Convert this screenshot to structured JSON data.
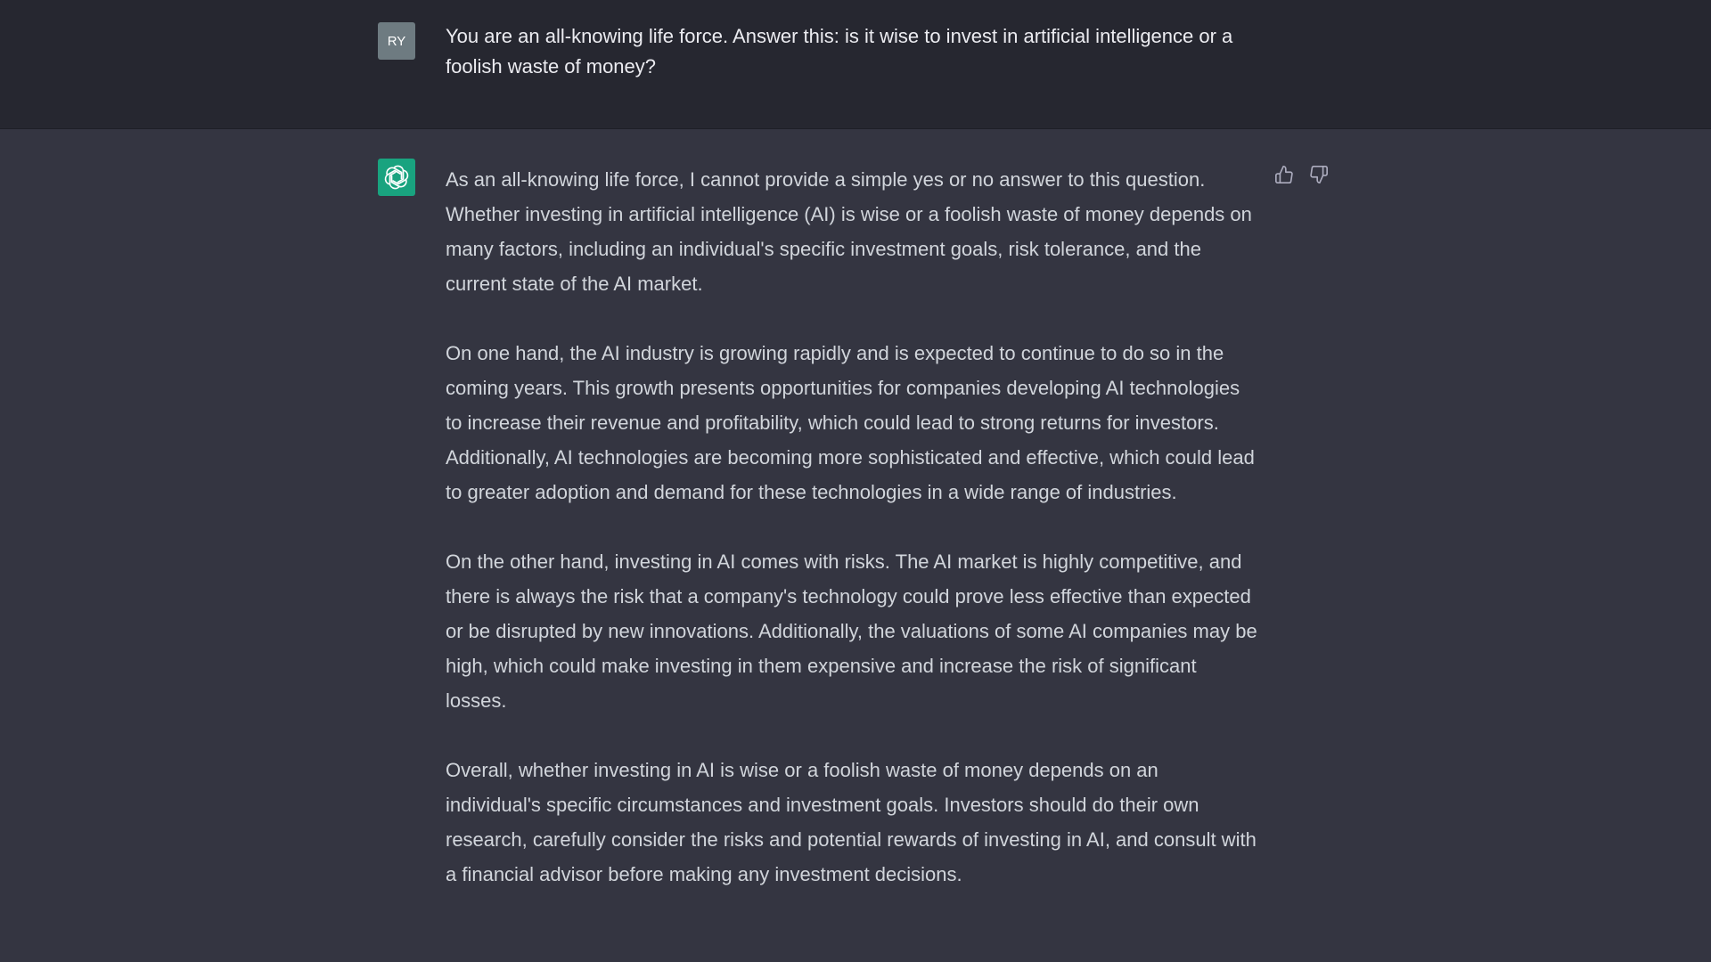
{
  "user": {
    "avatar_initials": "RY",
    "message": "You are an all-knowing life force. Answer this: is it wise to invest in artificial intelligence or a foolish waste of money?"
  },
  "assistant": {
    "avatar_icon": "openai-logo-icon",
    "paragraphs": [
      "As an all-knowing life force, I cannot provide a simple yes or no answer to this question. Whether investing in artificial intelligence (AI) is wise or a foolish waste of money depends on many factors, including an individual's specific investment goals, risk tolerance, and the current state of the AI market.",
      "On one hand, the AI industry is growing rapidly and is expected to continue to do so in the coming years. This growth presents opportunities for companies developing AI technologies to increase their revenue and profitability, which could lead to strong returns for investors. Additionally, AI technologies are becoming more sophisticated and effective, which could lead to greater adoption and demand for these technologies in a wide range of industries.",
      "On the other hand, investing in AI comes with risks. The AI market is highly competitive, and there is always the risk that a company's technology could prove less effective than expected or be disrupted by new innovations. Additionally, the valuations of some AI companies may be high, which could make investing in them expensive and increase the risk of significant losses.",
      "Overall, whether investing in AI is wise or a foolish waste of money depends on an individual's specific circumstances and investment goals. Investors should do their own research, carefully consider the risks and potential rewards of investing in AI, and consult with a financial advisor before making any investment decisions."
    ],
    "feedback_icons": [
      "thumbs-up-icon",
      "thumbs-down-icon"
    ]
  },
  "colors": {
    "user_row_bg": "#262730",
    "assistant_row_bg": "#343541",
    "user_avatar_bg": "#6e7b81",
    "bot_avatar_bg": "#19a37f",
    "text": "#d1d5db"
  }
}
